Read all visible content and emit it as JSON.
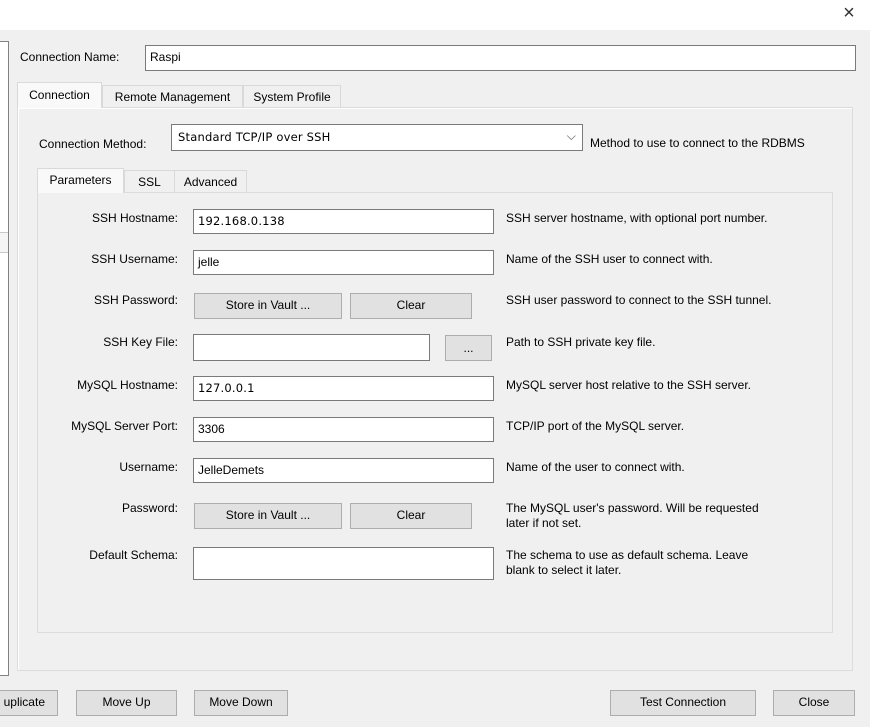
{
  "window": {
    "close_icon": "×"
  },
  "connection_name": {
    "label": "Connection Name:",
    "value": "Raspi"
  },
  "tabs": [
    {
      "label": "Connection",
      "active": true
    },
    {
      "label": "Remote Management",
      "active": false
    },
    {
      "label": "System Profile",
      "active": false
    }
  ],
  "connection_method": {
    "label": "Connection Method:",
    "value": "Standard TCP/IP over SSH",
    "description": "Method to use to connect to the RDBMS",
    "dropdown_icon": "⌵"
  },
  "subtabs": [
    {
      "label": "Parameters",
      "active": true
    },
    {
      "label": "SSL",
      "active": false
    },
    {
      "label": "Advanced",
      "active": false
    }
  ],
  "params": {
    "ssh_hostname": {
      "label": "SSH Hostname:",
      "value": "192.168.0.138",
      "description": "SSH server hostname, with  optional port number."
    },
    "ssh_username": {
      "label": "SSH Username:",
      "value": "jelle",
      "description": "Name of the SSH user to connect with."
    },
    "ssh_password": {
      "label": "SSH Password:",
      "store_label": "Store in Vault ...",
      "clear_label": "Clear",
      "description": "SSH user password to connect to the SSH tunnel."
    },
    "ssh_key_file": {
      "label": "SSH Key File:",
      "value": "",
      "browse_label": "...",
      "description": "Path to SSH private key file."
    },
    "mysql_hostname": {
      "label": "MySQL Hostname:",
      "value": "127.0.0.1",
      "description": "MySQL server host relative to the SSH server."
    },
    "mysql_port": {
      "label": "MySQL Server Port:",
      "value": "3306",
      "description": "TCP/IP port of the MySQL server."
    },
    "username": {
      "label": "Username:",
      "value": "JelleDemets",
      "description": "Name of the user to connect with."
    },
    "password": {
      "label": "Password:",
      "store_label": "Store in Vault ...",
      "clear_label": "Clear",
      "description_line1": "The MySQL user's password. Will be requested",
      "description_line2": "later if not set."
    },
    "default_schema": {
      "label": "Default Schema:",
      "value": "",
      "description_line1": "The schema to use as default schema. Leave",
      "description_line2": "blank to select it later."
    }
  },
  "footer": {
    "duplicate_label": "uplicate",
    "move_up_label": "Move Up",
    "move_down_label": "Move Down",
    "test_connection_label": "Test Connection",
    "close_label": "Close"
  }
}
